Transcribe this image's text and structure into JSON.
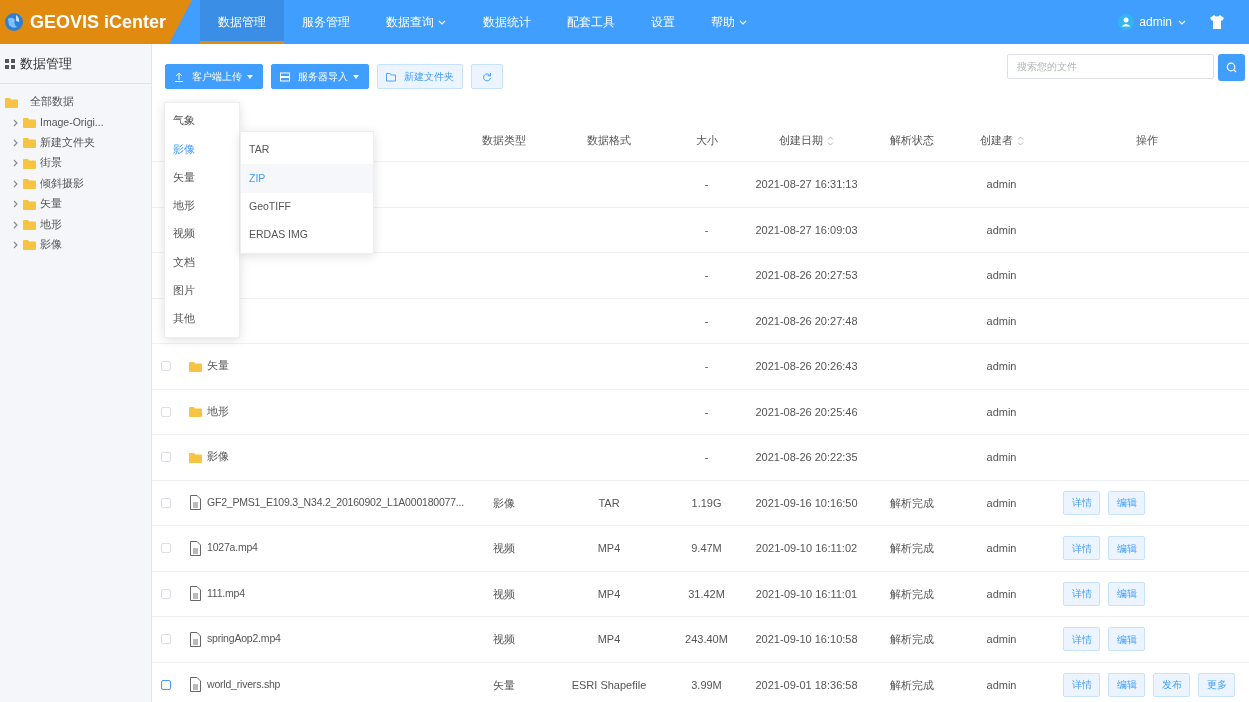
{
  "brand": {
    "name": "GEOVIS iCenter"
  },
  "nav": [
    {
      "label": "数据管理",
      "selected": true,
      "has_menu": false
    },
    {
      "label": "服务管理",
      "selected": false,
      "has_menu": false
    },
    {
      "label": "数据查询",
      "selected": false,
      "has_menu": true
    },
    {
      "label": "数据统计",
      "selected": false,
      "has_menu": false
    },
    {
      "label": "配套工具",
      "selected": false,
      "has_menu": false
    },
    {
      "label": "设置",
      "selected": false,
      "has_menu": false
    },
    {
      "label": "帮助",
      "selected": false,
      "has_menu": true
    }
  ],
  "user": {
    "name": "admin"
  },
  "sidebar": {
    "title": "数据管理",
    "tree": [
      {
        "label": "全部数据",
        "expanded": true,
        "children": [
          {
            "label": "Image-Origi...",
            "expanded": false
          },
          {
            "label": "新建文件夹",
            "expanded": false
          },
          {
            "label": "街景",
            "expanded": false
          },
          {
            "label": "倾斜摄影",
            "expanded": false
          },
          {
            "label": "矢量",
            "expanded": false
          },
          {
            "label": "地形",
            "expanded": false
          },
          {
            "label": "影像",
            "expanded": false
          }
        ]
      }
    ]
  },
  "toolbar": [
    {
      "label": "客户端上传",
      "kind": "primary",
      "has_menu": true
    },
    {
      "label": "服务器导入",
      "kind": "primary",
      "has_menu": true
    },
    {
      "label": "新建文件夹",
      "kind": "plain",
      "has_menu": false
    },
    {
      "kind": "plain",
      "has_menu": false
    }
  ],
  "search": {
    "placeholder": "搜索您的文件"
  },
  "upload_menu": {
    "items": [
      {
        "label": "气象",
        "selected": false
      },
      {
        "label": "影像",
        "selected": true
      },
      {
        "label": "矢量",
        "selected": false
      },
      {
        "label": "地形",
        "selected": false
      },
      {
        "label": "视频",
        "selected": false
      },
      {
        "label": "文档",
        "selected": false
      },
      {
        "label": "图片",
        "selected": false
      },
      {
        "label": "其他",
        "selected": false
      }
    ],
    "submenu": [
      {
        "label": "TAR",
        "selected": false
      },
      {
        "label": "ZIP",
        "selected": true
      },
      {
        "label": "GeoTIFF",
        "selected": false
      },
      {
        "label": "ERDAS IMG",
        "selected": false
      }
    ]
  },
  "table": {
    "columns": [
      {
        "label": "数据类型",
        "sortable": false
      },
      {
        "label": "数据格式",
        "sortable": false
      },
      {
        "label": "大小",
        "sortable": false
      },
      {
        "label": "创建日期",
        "sortable": true
      },
      {
        "label": "解析状态",
        "sortable": false
      },
      {
        "label": "创建者",
        "sortable": true
      },
      {
        "label": "操作",
        "sortable": false
      }
    ],
    "rows": [
      {
        "size": "-",
        "date": "2021-08-27 16:31:13",
        "creator": "admin"
      },
      {
        "size": "-",
        "date": "2021-08-27 16:09:03",
        "creator": "admin"
      },
      {
        "size": "-",
        "date": "2021-08-26 20:27:53",
        "creator": "admin"
      },
      {
        "size": "-",
        "date": "2021-08-26 20:27:48",
        "creator": "admin"
      },
      {
        "kind": "folder",
        "name": "矢量",
        "size": "-",
        "date": "2021-08-26 20:26:43",
        "creator": "admin",
        "hovered": false
      },
      {
        "kind": "folder",
        "name": "地形",
        "size": "-",
        "date": "2021-08-26 20:25:46",
        "creator": "admin",
        "hovered": false
      },
      {
        "kind": "folder",
        "name": "影像",
        "size": "-",
        "date": "2021-08-26 20:22:35",
        "creator": "admin",
        "hovered": false
      },
      {
        "kind": "file",
        "name": "GF2_PMS1_E109.3_N34.2_20160902_L1A000180077...",
        "type": "影像",
        "format": "TAR",
        "size": "1.19G",
        "date": "2021-09-16 10:16:50",
        "status": "解析完成",
        "creator": "admin",
        "actions": [
          "详情",
          "编辑"
        ],
        "hovered": false
      },
      {
        "kind": "file",
        "name": "1027a.mp4",
        "type": "视频",
        "format": "MP4",
        "size": "9.47M",
        "date": "2021-09-10 16:11:02",
        "status": "解析完成",
        "creator": "admin",
        "actions": [
          "详情",
          "编辑"
        ],
        "hovered": false
      },
      {
        "kind": "file",
        "name": "111.mp4",
        "type": "视频",
        "format": "MP4",
        "size": "31.42M",
        "date": "2021-09-10 16:11:01",
        "status": "解析完成",
        "creator": "admin",
        "actions": [
          "详情",
          "编辑"
        ],
        "hovered": false
      },
      {
        "kind": "file",
        "name": "springAop2.mp4",
        "type": "视频",
        "format": "MP4",
        "size": "243.40M",
        "date": "2021-09-10 16:10:58",
        "status": "解析完成",
        "creator": "admin",
        "actions": [
          "详情",
          "编辑"
        ],
        "hovered": false
      },
      {
        "kind": "file",
        "name": "world_rivers.shp",
        "type": "矢量",
        "format": "ESRI Shapefile",
        "size": "3.99M",
        "date": "2021-09-01 18:36:58",
        "status": "解析完成",
        "creator": "admin",
        "actions": [
          "详情",
          "编辑",
          "发布",
          "更多"
        ],
        "hovered": true
      }
    ]
  }
}
